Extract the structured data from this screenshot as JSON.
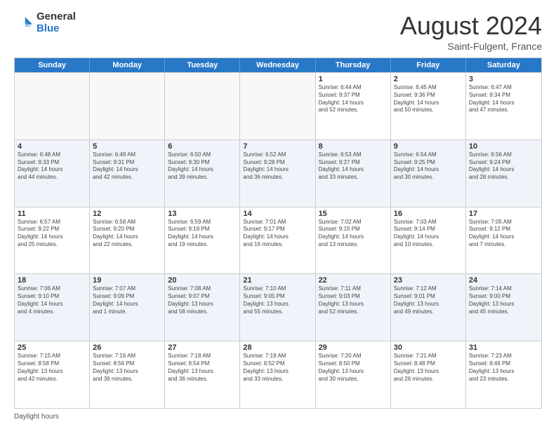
{
  "header": {
    "logo_general": "General",
    "logo_blue": "Blue",
    "month_title": "August 2024",
    "subtitle": "Saint-Fulgent, France"
  },
  "days_of_week": [
    "Sunday",
    "Monday",
    "Tuesday",
    "Wednesday",
    "Thursday",
    "Friday",
    "Saturday"
  ],
  "footer_label": "Daylight hours",
  "weeks": [
    [
      {
        "day": "",
        "info": ""
      },
      {
        "day": "",
        "info": ""
      },
      {
        "day": "",
        "info": ""
      },
      {
        "day": "",
        "info": ""
      },
      {
        "day": "1",
        "info": "Sunrise: 6:44 AM\nSunset: 9:37 PM\nDaylight: 14 hours\nand 52 minutes."
      },
      {
        "day": "2",
        "info": "Sunrise: 6:45 AM\nSunset: 9:36 PM\nDaylight: 14 hours\nand 50 minutes."
      },
      {
        "day": "3",
        "info": "Sunrise: 6:47 AM\nSunset: 9:34 PM\nDaylight: 14 hours\nand 47 minutes."
      }
    ],
    [
      {
        "day": "4",
        "info": "Sunrise: 6:48 AM\nSunset: 9:33 PM\nDaylight: 14 hours\nand 44 minutes."
      },
      {
        "day": "5",
        "info": "Sunrise: 6:49 AM\nSunset: 9:31 PM\nDaylight: 14 hours\nand 42 minutes."
      },
      {
        "day": "6",
        "info": "Sunrise: 6:50 AM\nSunset: 9:30 PM\nDaylight: 14 hours\nand 39 minutes."
      },
      {
        "day": "7",
        "info": "Sunrise: 6:52 AM\nSunset: 9:28 PM\nDaylight: 14 hours\nand 36 minutes."
      },
      {
        "day": "8",
        "info": "Sunrise: 6:53 AM\nSunset: 9:27 PM\nDaylight: 14 hours\nand 33 minutes."
      },
      {
        "day": "9",
        "info": "Sunrise: 6:54 AM\nSunset: 9:25 PM\nDaylight: 14 hours\nand 30 minutes."
      },
      {
        "day": "10",
        "info": "Sunrise: 6:56 AM\nSunset: 9:24 PM\nDaylight: 14 hours\nand 28 minutes."
      }
    ],
    [
      {
        "day": "11",
        "info": "Sunrise: 6:57 AM\nSunset: 9:22 PM\nDaylight: 14 hours\nand 25 minutes."
      },
      {
        "day": "12",
        "info": "Sunrise: 6:58 AM\nSunset: 9:20 PM\nDaylight: 14 hours\nand 22 minutes."
      },
      {
        "day": "13",
        "info": "Sunrise: 6:59 AM\nSunset: 9:19 PM\nDaylight: 14 hours\nand 19 minutes."
      },
      {
        "day": "14",
        "info": "Sunrise: 7:01 AM\nSunset: 9:17 PM\nDaylight: 14 hours\nand 16 minutes."
      },
      {
        "day": "15",
        "info": "Sunrise: 7:02 AM\nSunset: 9:15 PM\nDaylight: 14 hours\nand 13 minutes."
      },
      {
        "day": "16",
        "info": "Sunrise: 7:03 AM\nSunset: 9:14 PM\nDaylight: 14 hours\nand 10 minutes."
      },
      {
        "day": "17",
        "info": "Sunrise: 7:05 AM\nSunset: 9:12 PM\nDaylight: 14 hours\nand 7 minutes."
      }
    ],
    [
      {
        "day": "18",
        "info": "Sunrise: 7:06 AM\nSunset: 9:10 PM\nDaylight: 14 hours\nand 4 minutes."
      },
      {
        "day": "19",
        "info": "Sunrise: 7:07 AM\nSunset: 9:09 PM\nDaylight: 14 hours\nand 1 minute."
      },
      {
        "day": "20",
        "info": "Sunrise: 7:08 AM\nSunset: 9:07 PM\nDaylight: 13 hours\nand 58 minutes."
      },
      {
        "day": "21",
        "info": "Sunrise: 7:10 AM\nSunset: 9:05 PM\nDaylight: 13 hours\nand 55 minutes."
      },
      {
        "day": "22",
        "info": "Sunrise: 7:11 AM\nSunset: 9:03 PM\nDaylight: 13 hours\nand 52 minutes."
      },
      {
        "day": "23",
        "info": "Sunrise: 7:12 AM\nSunset: 9:01 PM\nDaylight: 13 hours\nand 49 minutes."
      },
      {
        "day": "24",
        "info": "Sunrise: 7:14 AM\nSunset: 9:00 PM\nDaylight: 13 hours\nand 45 minutes."
      }
    ],
    [
      {
        "day": "25",
        "info": "Sunrise: 7:15 AM\nSunset: 8:58 PM\nDaylight: 13 hours\nand 42 minutes."
      },
      {
        "day": "26",
        "info": "Sunrise: 7:16 AM\nSunset: 8:56 PM\nDaylight: 13 hours\nand 39 minutes."
      },
      {
        "day": "27",
        "info": "Sunrise: 7:18 AM\nSunset: 8:54 PM\nDaylight: 13 hours\nand 36 minutes."
      },
      {
        "day": "28",
        "info": "Sunrise: 7:19 AM\nSunset: 8:52 PM\nDaylight: 13 hours\nand 33 minutes."
      },
      {
        "day": "29",
        "info": "Sunrise: 7:20 AM\nSunset: 8:50 PM\nDaylight: 13 hours\nand 30 minutes."
      },
      {
        "day": "30",
        "info": "Sunrise: 7:21 AM\nSunset: 8:48 PM\nDaylight: 13 hours\nand 26 minutes."
      },
      {
        "day": "31",
        "info": "Sunrise: 7:23 AM\nSunset: 8:46 PM\nDaylight: 13 hours\nand 23 minutes."
      }
    ]
  ]
}
